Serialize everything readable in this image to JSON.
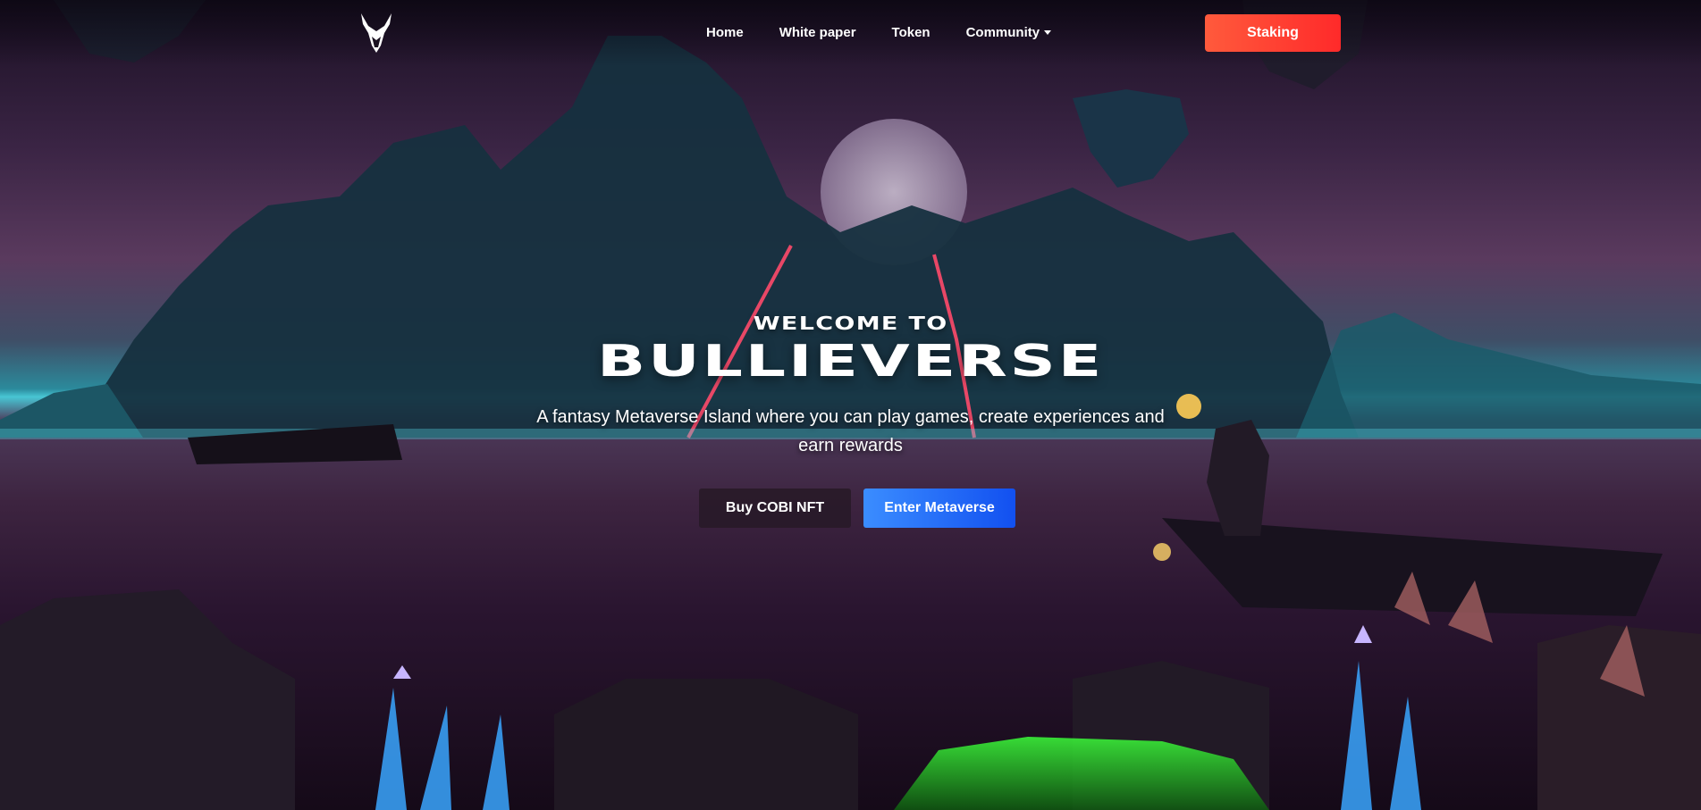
{
  "nav": {
    "logo_icon": "bull-head-icon",
    "links": [
      {
        "label": "Home"
      },
      {
        "label": "White paper"
      },
      {
        "label": "Token"
      },
      {
        "label": "Community",
        "has_dropdown": true
      }
    ],
    "staking_label": "Staking"
  },
  "hero": {
    "welcome": "WELCOME TO",
    "title": "BULLIEVERSE",
    "tagline": "A fantasy Metaverse Island where you can play games, create experiences and earn rewards",
    "buy_label": "Buy COBI NFT",
    "enter_label": "Enter Metaverse"
  },
  "colors": {
    "staking_gradient_start": "#ff5a3c",
    "staking_gradient_end": "#ff2a2a",
    "enter_gradient_start": "#3b8dff",
    "enter_gradient_end": "#1250f0",
    "buy_bg": "#281a28"
  }
}
